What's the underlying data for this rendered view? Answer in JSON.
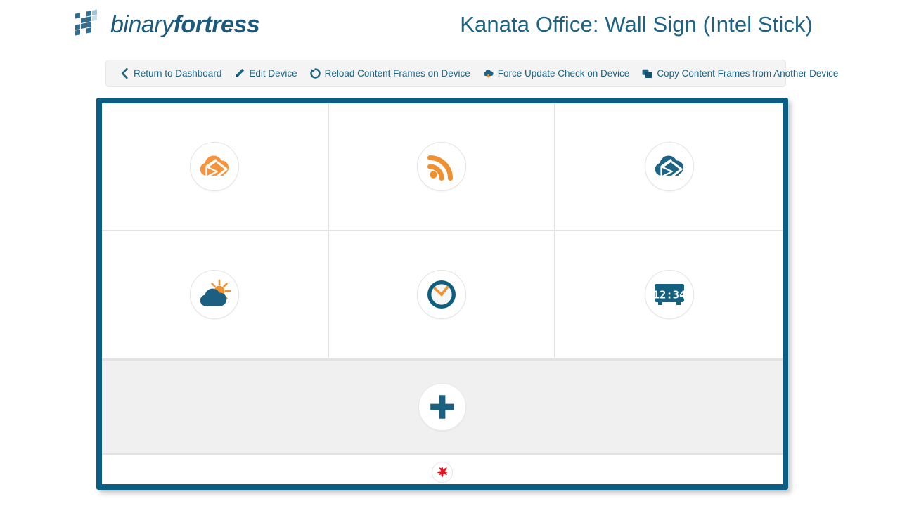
{
  "header": {
    "logo": {
      "icon_name": "binaryfortress-grid-logo",
      "text_light": "binary",
      "text_bold": "fortress",
      "color": "#1c5a7d"
    },
    "page_title": "Kanata Office: Wall Sign (Intel Stick)",
    "title_color": "#1c6384"
  },
  "toolbar": {
    "background": "#f4f4f4",
    "link_color": "#1c6384",
    "items": [
      {
        "label": "Return to Dashboard",
        "icon": "chevron-left-icon"
      },
      {
        "label": "Edit Device",
        "icon": "pencil-icon"
      },
      {
        "label": "Reload Content Frames on Device",
        "icon": "refresh-icon"
      },
      {
        "label": "Force Update Check on Device",
        "icon": "cloud-download-icon"
      },
      {
        "label": "Copy Content Frames from Another Device",
        "icon": "copy-icon"
      }
    ]
  },
  "frames_panel": {
    "border_color": "#0b5e83",
    "frames": [
      {
        "icon": "cloud-play-icon",
        "color": "#f5943c",
        "label": "Cloud Content Frame"
      },
      {
        "icon": "rss-feed-icon",
        "color": "#f5943c",
        "label": "RSS Feed Frame"
      },
      {
        "icon": "cloud-play-icon",
        "color": "#1c6384",
        "label": "Cloud Content Frame"
      },
      {
        "icon": "weather-icon",
        "color": "#1c6384",
        "label": "Weather Frame"
      },
      {
        "icon": "analog-clock-icon",
        "color": "#1c6384",
        "label": "Analog Clock Frame"
      },
      {
        "icon": "digital-clock-icon",
        "color": "#1c6384",
        "label": "Digital Clock Frame",
        "display_value": "12:34"
      }
    ],
    "add_button": {
      "icon": "plus-icon",
      "color": "#1c6384",
      "label": "Add Content Frame"
    },
    "status_bar": {
      "icon": "cbc-gem-icon",
      "color": "#e4121e",
      "label": "CBC"
    }
  }
}
